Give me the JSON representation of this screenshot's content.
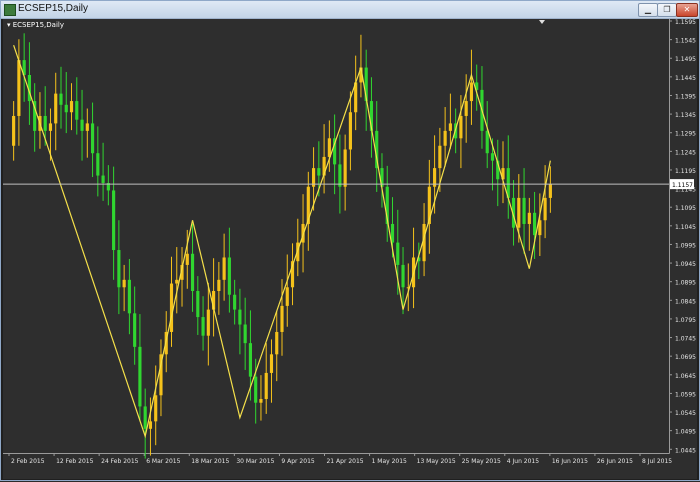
{
  "window": {
    "title": "ECSEP15,Daily",
    "chart_label": "ECSEP15,Daily",
    "buttons": {
      "minimize": "▁",
      "restore": "❐",
      "close": "✕"
    }
  },
  "colors": {
    "background": "#2e2e2e",
    "bull": "#f5c21b",
    "bear": "#30d630",
    "zigzag": "#f5e04a",
    "price_line": "#c0c0c0",
    "axis_text": "#e6e6e6",
    "price_tag_bg": "#ffffff"
  },
  "chart_data": {
    "type": "candlestick",
    "symbol": "ECSEP15",
    "timeframe": "Daily",
    "ylim": [
      1.0435,
      1.1595
    ],
    "y_ticks": [
      "1.1595",
      "1.1545",
      "1.1495",
      "1.1445",
      "1.1395",
      "1.1345",
      "1.1295",
      "1.1245",
      "1.1195",
      "1.1145",
      "1.1095",
      "1.1045",
      "1.0995",
      "1.0945",
      "1.0895",
      "1.0845",
      "1.0795",
      "1.0745",
      "1.0695",
      "1.0645",
      "1.0595",
      "1.0545",
      "1.0495",
      "1.0445"
    ],
    "x_labels": [
      "2 Feb 2015",
      "12 Feb 2015",
      "24 Feb 2015",
      "6 Mar 2015",
      "18 Mar 2015",
      "30 Mar 2015",
      "9 Apr 2015",
      "21 Apr 2015",
      "1 May 2015",
      "13 May 2015",
      "25 May 2015",
      "4 Jun 2015",
      "16 Jun 2015",
      "26 Jun 2015",
      "8 Jul 2015"
    ],
    "current_price": 1.1157,
    "closes": [
      1.134,
      1.149,
      1.145,
      1.138,
      1.13,
      1.134,
      1.13,
      1.132,
      1.14,
      1.137,
      1.135,
      1.138,
      1.133,
      1.13,
      1.132,
      1.124,
      1.118,
      1.116,
      1.114,
      1.098,
      1.088,
      1.09,
      1.081,
      1.072,
      1.056,
      1.05,
      1.052,
      1.059,
      1.07,
      1.076,
      1.089,
      1.09,
      1.094,
      1.097,
      1.087,
      1.08,
      1.075,
      1.082,
      1.087,
      1.09,
      1.096,
      1.086,
      1.082,
      1.078,
      1.073,
      1.064,
      1.057,
      1.058,
      1.065,
      1.07,
      1.076,
      1.083,
      1.088,
      1.095,
      1.1,
      1.105,
      1.115,
      1.12,
      1.118,
      1.123,
      1.128,
      1.121,
      1.115,
      1.125,
      1.135,
      1.143,
      1.147,
      1.138,
      1.13,
      1.12,
      1.115,
      1.105,
      1.1,
      1.094,
      1.088,
      1.088,
      1.096,
      1.095,
      1.105,
      1.115,
      1.12,
      1.126,
      1.13,
      1.132,
      1.128,
      1.134,
      1.138,
      1.143,
      1.141,
      1.13,
      1.124,
      1.122,
      1.117,
      1.12,
      1.112,
      1.104,
      1.112,
      1.105,
      1.108,
      1.102,
      1.106,
      1.112,
      1.1157
    ],
    "zigzag": [
      {
        "i": 0,
        "price": 1.153
      },
      {
        "i": 25,
        "price": 1.048
      },
      {
        "i": 34,
        "price": 1.106
      },
      {
        "i": 43,
        "price": 1.053
      },
      {
        "i": 66,
        "price": 1.147
      },
      {
        "i": 74,
        "price": 1.082
      },
      {
        "i": 87,
        "price": 1.145
      },
      {
        "i": 98,
        "price": 1.093
      },
      {
        "i": 102,
        "price": 1.122
      }
    ]
  }
}
